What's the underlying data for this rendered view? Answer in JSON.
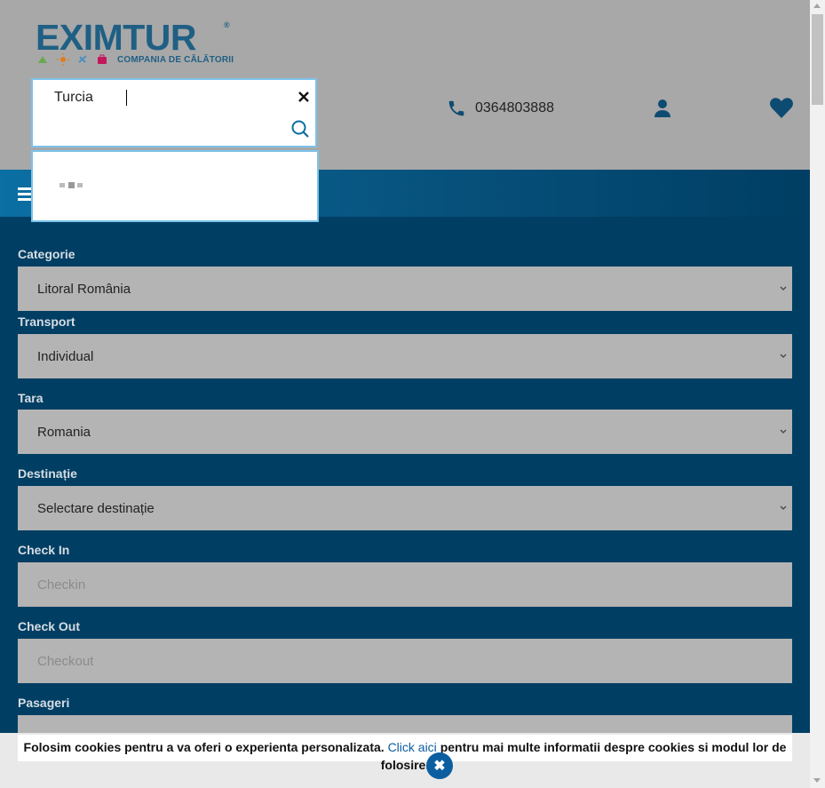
{
  "header": {
    "logo_text": "EXIMTUR",
    "logo_registered": "®",
    "logo_tagline": "COMPANIA DE CĂLĂTORII",
    "phone": "0364803888"
  },
  "search": {
    "value": "Turcia"
  },
  "form": {
    "fields": [
      {
        "label": "Categorie",
        "value": "Litoral România",
        "type": "select"
      },
      {
        "label": "Transport",
        "value": "Individual",
        "type": "select"
      },
      {
        "label": "Tara",
        "value": "Romania",
        "type": "select"
      },
      {
        "label": "Destinație",
        "value": "Selectare destinație",
        "type": "select"
      },
      {
        "label": "Check In",
        "placeholder": "Checkin",
        "type": "input"
      },
      {
        "label": "Check Out",
        "placeholder": "Checkout",
        "type": "input"
      },
      {
        "label": "Pasageri",
        "value": "",
        "type": "select"
      }
    ]
  },
  "cookie": {
    "text_before": "Folosim cookies pentru a va oferi o experienta personalizata.",
    "link_text": "Click aici",
    "text_after": "pentru mai multe informatii despre cookies si modul lor de folosire.",
    "close_symbol": "✖"
  },
  "colors": {
    "brand": "#1f5f84",
    "page_bg": "#003e63",
    "accent": "#0b5ea0"
  }
}
